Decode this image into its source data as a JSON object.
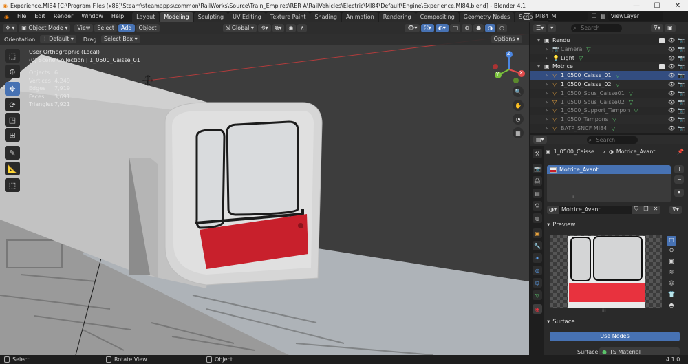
{
  "window": {
    "title": "Experience.MI84 [C:\\Program Files (x86)\\Steam\\steamapps\\common\\RailWorks\\Source\\Train_Empires\\RER A\\RailVehicles\\Electric\\MI84\\Default\\Engine\\Experience.MI84.blend] - Blender 4.1",
    "minimize": "—",
    "maximize": "☐",
    "close": "✕"
  },
  "menus": [
    "File",
    "Edit",
    "Render",
    "Window",
    "Help"
  ],
  "workspaces": [
    {
      "label": "Layout",
      "active": false
    },
    {
      "label": "Modeling",
      "active": true
    },
    {
      "label": "Sculpting",
      "active": false
    },
    {
      "label": "UV Editing",
      "active": false
    },
    {
      "label": "Texture Paint",
      "active": false
    },
    {
      "label": "Shading",
      "active": false
    },
    {
      "label": "Animation",
      "active": false
    },
    {
      "label": "Rendering",
      "active": false
    },
    {
      "label": "Compositing",
      "active": false
    },
    {
      "label": "Geometry Nodes",
      "active": false
    },
    {
      "label": "Scripting",
      "active": false
    }
  ],
  "add_workspace": "+",
  "scene": {
    "name": "MI84_M",
    "view_layer": "ViewLayer"
  },
  "viewport_header": {
    "mode": "Object Mode",
    "menus": [
      "View",
      "Select",
      "Add",
      "Object"
    ],
    "transform": "Global",
    "orientation_label": "Orientation:",
    "orientation": "Default",
    "drag_label": "Drag:",
    "drag": "Select Box",
    "options": "Options"
  },
  "viewport": {
    "view_name": "User Orthographic (Local)",
    "collection": "(0) Scene Collection | 1_0500_Caisse_01",
    "stats": [
      {
        "label": "Objects",
        "value": "6"
      },
      {
        "label": "Vertices",
        "value": "4,249"
      },
      {
        "label": "Edges",
        "value": "7,919"
      },
      {
        "label": "Faces",
        "value": "3,691"
      },
      {
        "label": "Triangles",
        "value": "7,921"
      }
    ],
    "gizmo": {
      "x": "X",
      "y": "Y",
      "z": "Z"
    }
  },
  "outliner": {
    "search_placeholder": "Search",
    "rows": [
      {
        "label": "Rendu",
        "indent": 0,
        "type": "collection",
        "dim": false
      },
      {
        "label": "Camera",
        "indent": 1,
        "type": "camera",
        "dim": true
      },
      {
        "label": "Light",
        "indent": 1,
        "type": "light",
        "dim": false
      },
      {
        "label": "Motrice",
        "indent": 0,
        "type": "collection",
        "dim": false
      },
      {
        "label": "1_0500_Caisse_01",
        "indent": 1,
        "type": "mesh",
        "dim": false
      },
      {
        "label": "1_0500_Caisse_02",
        "indent": 1,
        "type": "mesh",
        "dim": false
      },
      {
        "label": "1_0500_Sous_Caisse01",
        "indent": 1,
        "type": "mesh",
        "dim": true
      },
      {
        "label": "1_0500_Sous_Caisse02",
        "indent": 1,
        "type": "mesh",
        "dim": true
      },
      {
        "label": "1_0500_Support_Tampon",
        "indent": 1,
        "type": "mesh",
        "dim": true
      },
      {
        "label": "1_0500_Tampons",
        "indent": 1,
        "type": "mesh",
        "dim": true
      },
      {
        "label": "BATP_SNCF MI84",
        "indent": 1,
        "type": "mesh",
        "dim": true
      }
    ]
  },
  "properties": {
    "search_placeholder": "Search",
    "object_name": "1_0500_Caisse...",
    "material_breadcrumb": "Motrice_Avant",
    "slots": [
      {
        "label": "Motrice_Avant"
      }
    ],
    "material_name": "Motrice_Avant",
    "sections": {
      "preview": "Preview",
      "surface": "Surface",
      "use_nodes": "Use Nodes",
      "surface_label": "Surface",
      "surface_value": "TS Material"
    },
    "plus": "+",
    "minus": "−",
    "more": "⋮"
  },
  "statusbar": {
    "select": "Select",
    "rotate": "Rotate View",
    "object": "Object",
    "version": "4.1.0"
  },
  "colors": {
    "accent": "#4772b3",
    "red_panel": "#c8202c",
    "window_glass": "#d9d9d9"
  }
}
